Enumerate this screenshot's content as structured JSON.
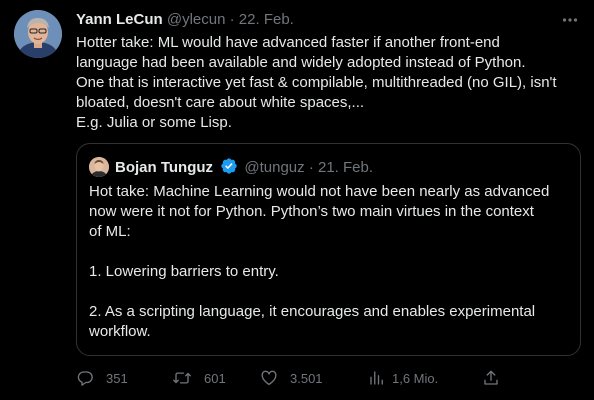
{
  "author": {
    "name": "Yann LeCun",
    "handle": "@ylecun",
    "separator": "·",
    "date": "22. Feb."
  },
  "tweet": {
    "lines": [
      "Hotter take: ML would have advanced faster if another front-end",
      "language had been available and widely adopted instead of Python.",
      "One that is interactive yet fast & compilable, multithreaded (no GIL), isn't",
      "bloated, doesn't care about white spaces,...",
      "E.g. Julia or some Lisp."
    ]
  },
  "quoted": {
    "name": "Bojan Tunguz",
    "handle": "@tunguz",
    "separator": "·",
    "date": "21. Feb.",
    "lines": [
      "Hot take: Machine Learning would not have been nearly as advanced",
      "now were it not for Python. Python’s two main virtues in the context",
      "of ML:",
      "",
      "1. Lowering barriers to entry.",
      "",
      "2. As a scripting language, it encourages and enables experimental",
      "workflow."
    ]
  },
  "actions": {
    "replies": "351",
    "retweets": "601",
    "likes": "3.501",
    "views": "1,6 Mio."
  },
  "icons": {
    "more": "more-horizontal-icon",
    "reply": "reply-icon",
    "retweet": "retweet-icon",
    "like": "heart-icon",
    "views": "views-icon",
    "share": "share-icon",
    "verified": "verified-badge-icon"
  },
  "colors": {
    "background": "#000000",
    "text": "#e7e9ea",
    "muted": "#71767b",
    "border": "#2f3336",
    "verified": "#1d9bf0"
  }
}
